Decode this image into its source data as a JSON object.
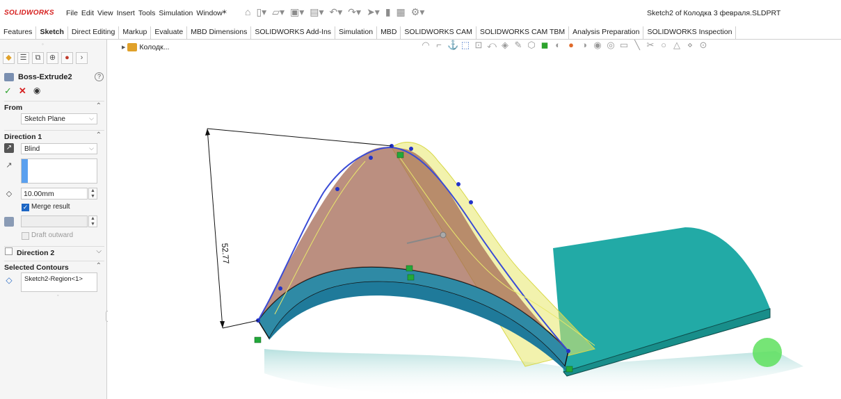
{
  "app": {
    "logo": "SOLIDWORKS",
    "menu": [
      "File",
      "Edit",
      "View",
      "Insert",
      "Tools",
      "Simulation",
      "Window"
    ],
    "document_title": "Sketch2 of Колодка 3 февраля.SLDPRT"
  },
  "tabs": [
    {
      "label": "Features",
      "active": false
    },
    {
      "label": "Sketch",
      "active": true
    },
    {
      "label": "Direct Editing",
      "active": false
    },
    {
      "label": "Markup",
      "active": false
    },
    {
      "label": "Evaluate",
      "active": false
    },
    {
      "label": "MBD Dimensions",
      "active": false
    },
    {
      "label": "SOLIDWORKS Add-Ins",
      "active": false
    },
    {
      "label": "Simulation",
      "active": false
    },
    {
      "label": "MBD",
      "active": false
    },
    {
      "label": "SOLIDWORKS CAM",
      "active": false
    },
    {
      "label": "SOLIDWORKS CAM TBM",
      "active": false
    },
    {
      "label": "Analysis Preparation",
      "active": false
    },
    {
      "label": "SOLIDWORKS Inspection",
      "active": false
    }
  ],
  "property_manager": {
    "feature_name": "Boss-Extrude2",
    "help": "?",
    "from": {
      "label": "From",
      "value": "Sketch Plane"
    },
    "direction1": {
      "label": "Direction 1",
      "end_condition": "Blind",
      "depth": "10.00mm",
      "merge_result_label": "Merge result",
      "merge_result_checked": true,
      "draft_outward_label": "Draft outward",
      "draft_outward_checked": false
    },
    "direction2": {
      "label": "Direction 2",
      "checked": false
    },
    "selected_contours": {
      "label": "Selected Contours",
      "value": "Sketch2-Region<1>"
    }
  },
  "viewport": {
    "tree_flyout_label": "Колодк...",
    "dimension_value": "52.77",
    "colors": {
      "solid_face": "#1fa39f",
      "solid_top": "#22aaa6",
      "preview_fill": "#b8846a",
      "preview_yellow": "#e8e86a",
      "sketch_line": "#3a4bd6",
      "selection_dot": "#5ee05e",
      "relation_marker": "#22a83a"
    }
  },
  "icons": {
    "ok": "✓",
    "cancel": "✕",
    "preview": "◉",
    "pin": "📌"
  }
}
